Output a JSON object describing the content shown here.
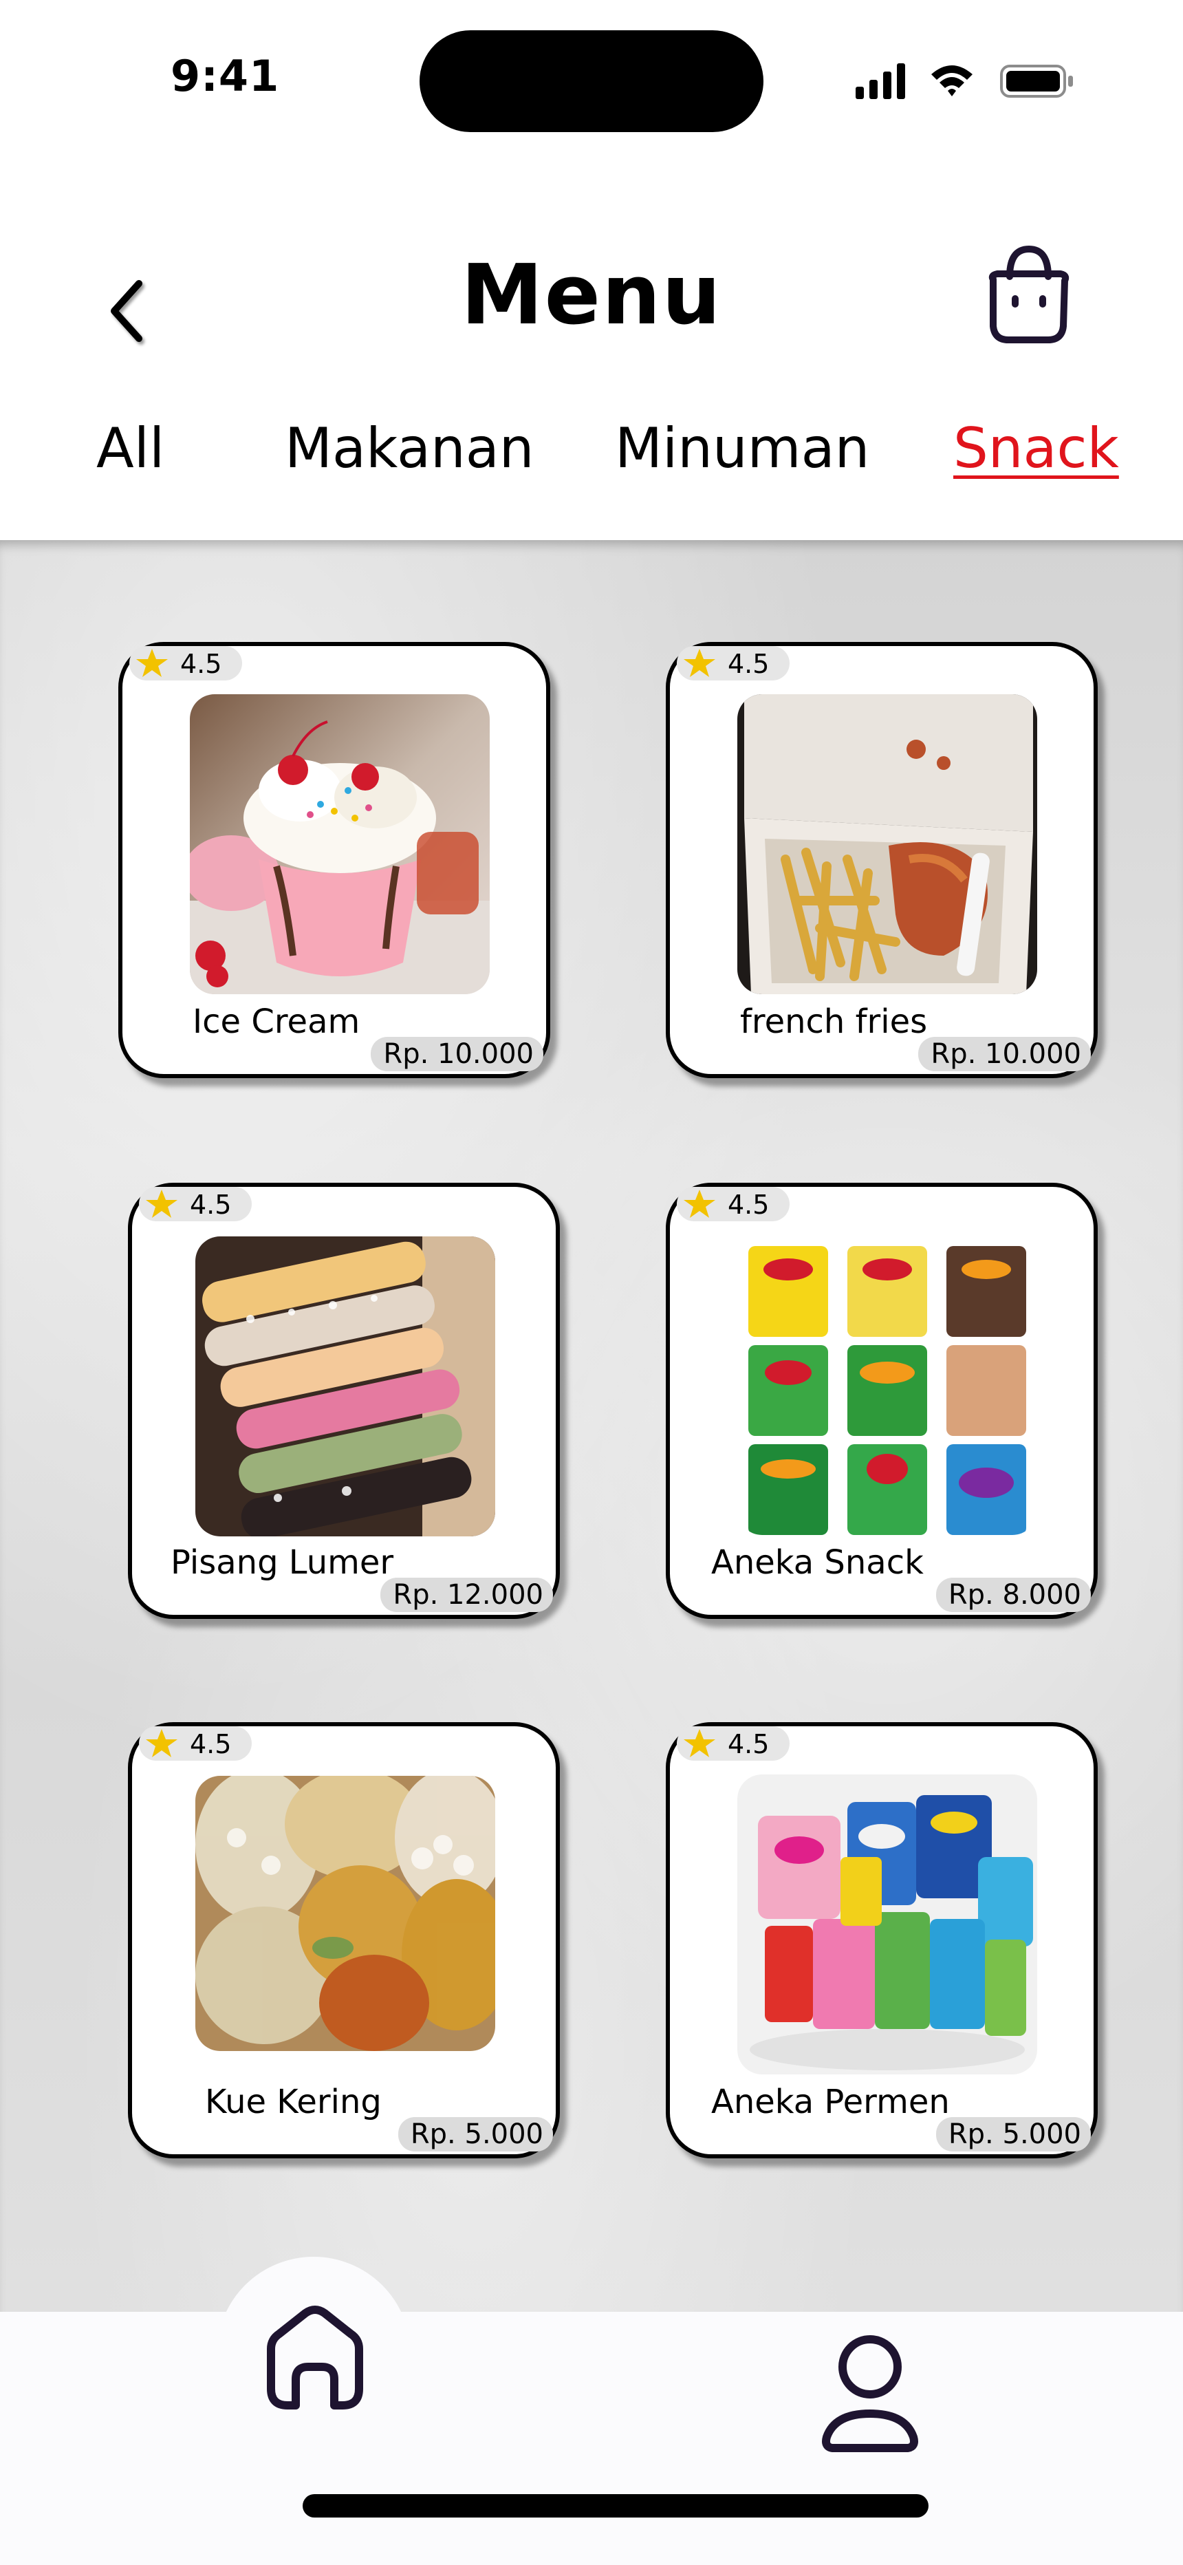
{
  "status_bar": {
    "time": "9:41"
  },
  "header": {
    "title": "Menu",
    "back_icon": "chevron-left-icon",
    "cart_icon": "shopping-bag-icon"
  },
  "tabs": [
    {
      "label": "All",
      "active": false
    },
    {
      "label": "Makanan",
      "active": false
    },
    {
      "label": "Minuman",
      "active": false
    },
    {
      "label": "Snack",
      "active": true
    }
  ],
  "products": [
    {
      "name": "Ice Cream",
      "rating": "4.5",
      "price": "Rp. 10.000"
    },
    {
      "name": "french fries",
      "rating": "4.5",
      "price": "Rp. 10.000"
    },
    {
      "name": "Pisang Lumer",
      "rating": "4.5",
      "price": "Rp. 12.000"
    },
    {
      "name": "Aneka Snack",
      "rating": "4.5",
      "price": "Rp. 8.000"
    },
    {
      "name": "Kue Kering",
      "rating": "4.5",
      "price": "Rp. 5.000"
    },
    {
      "name": "Aneka Permen",
      "rating": "4.5",
      "price": "Rp. 5.000"
    }
  ],
  "bottom_nav": {
    "items": [
      "home-icon",
      "profile-icon"
    ]
  },
  "colors": {
    "active_tab": "#e0141c",
    "icon": "#1e1430"
  }
}
